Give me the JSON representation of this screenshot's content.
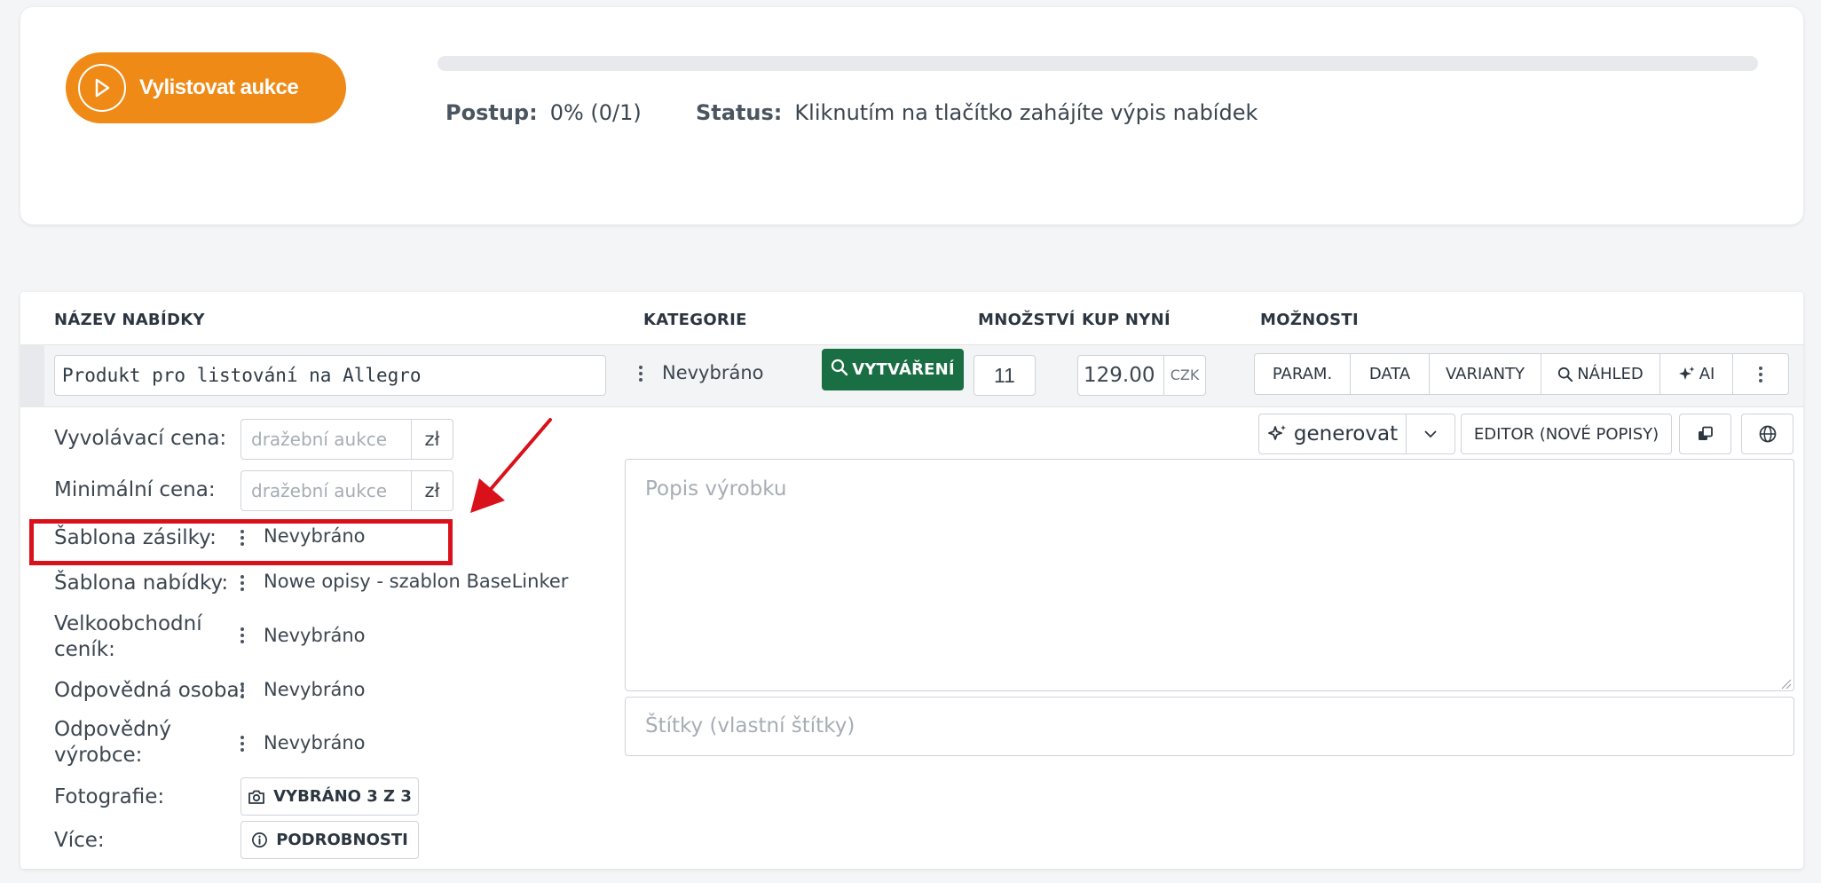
{
  "top": {
    "list_button_label": "Vylistovat aukce",
    "progress_label": "Postup:",
    "progress_value": "0% (0/1)",
    "progress_fraction": 0,
    "status_label": "Status:",
    "status_text": "Kliknutím na tlačítko zahájíte výpis nabídek"
  },
  "table": {
    "headers": {
      "name": "NÁZEV NABÍDKY",
      "category": "KATEGORIE",
      "quantity": "MNOŽSTVÍ",
      "buy_now": "KUP NYNÍ",
      "options": "MOŽNOSTI"
    },
    "row": {
      "title": "Produkt pro listování na Allegro",
      "category": "Nevybráno",
      "create_label": "VYTVÁŘENÍ",
      "quantity": "11",
      "price": "129.00",
      "currency": "CZK"
    },
    "options": [
      "PARAM.",
      "DATA",
      "VARIANTY",
      "NÁHLED",
      "AI"
    ]
  },
  "details": {
    "starting_price_label": "Vyvolávací cena:",
    "starting_price_placeholder": "dražební aukce",
    "min_price_label": "Minimální cena:",
    "min_price_placeholder": "dražební aukce",
    "unit": "zł",
    "shipping_template_label": "Šablona zásilky:",
    "shipping_template_value": "Nevybráno",
    "offer_template_label": "Šablona nabídky:",
    "offer_template_value": "Nowe opisy - szablon BaseLinker",
    "wholesale_label_1": "Velkoobchodní",
    "wholesale_label_2": "ceník:",
    "wholesale_value": "Nevybráno",
    "responsible_person_label": "Odpovědná osoba:",
    "responsible_person_value": "Nevybráno",
    "responsible_producer_label_1": "Odpovědný",
    "responsible_producer_label_2": "výrobce:",
    "responsible_producer_value": "Nevybráno",
    "photos_label": "Fotografie:",
    "photos_button": "VYBRÁNO 3 Z 3",
    "more_label": "Více:",
    "more_button": "PODROBNOSTI"
  },
  "description": {
    "generate_label": "generovat",
    "editor_label": "EDITOR (NOVÉ POPISY)",
    "description_placeholder": "Popis výrobku",
    "tags_placeholder": "Štítky (vlastní štítky)"
  },
  "colors": {
    "accent": "#ef8a17",
    "create_green": "#1a6e43",
    "highlight_red": "#d9111a"
  }
}
